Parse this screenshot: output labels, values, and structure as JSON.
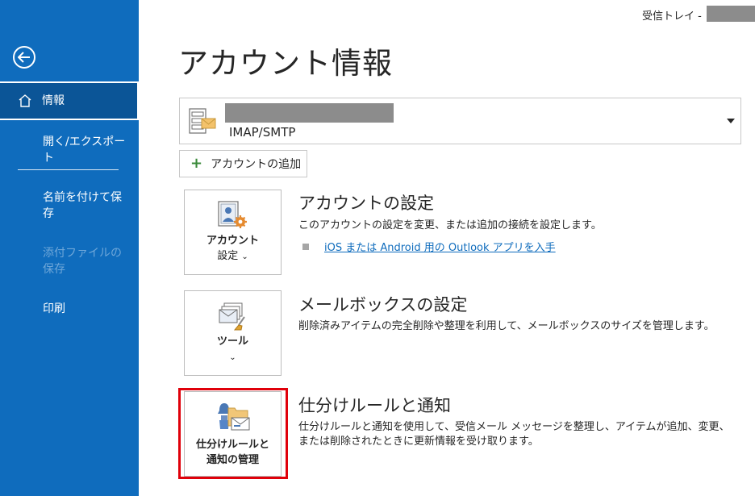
{
  "header": {
    "folder_label": "受信トレイ -"
  },
  "sidebar": {
    "items": [
      {
        "label": "情報"
      },
      {
        "label": "開く/エクスポート"
      },
      {
        "label": "名前を付けて保存"
      },
      {
        "label": "添付ファイルの保存"
      },
      {
        "label": "印刷"
      }
    ]
  },
  "main": {
    "title": "アカウント情報",
    "account": {
      "type": "IMAP/SMTP"
    },
    "add_account_label": "アカウントの追加",
    "sections": [
      {
        "tile_label_1": "アカウント",
        "tile_label_2": "設定",
        "title": "アカウントの設定",
        "description": "このアカウントの設定を変更、または追加の接続を設定します。",
        "link": "iOS または Android 用の Outlook アプリを入手"
      },
      {
        "tile_label_1": "ツール",
        "title": "メールボックスの設定",
        "description": "削除済みアイテムの完全削除や整理を利用して、メールボックスのサイズを管理します。"
      },
      {
        "tile_label_1": "仕分けルールと",
        "tile_label_2": "通知の管理",
        "title": "仕分けルールと通知",
        "description": "仕分けルールと通知を使用して、受信メール メッセージを整理し、アイテムが追加、変更、または削除されたときに更新情報を受け取ります。"
      }
    ]
  },
  "colors": {
    "sidebar_bg": "#0f6cbd",
    "sidebar_selected": "#0b5597",
    "link": "#0f6cbd",
    "highlight": "#e0000a"
  }
}
